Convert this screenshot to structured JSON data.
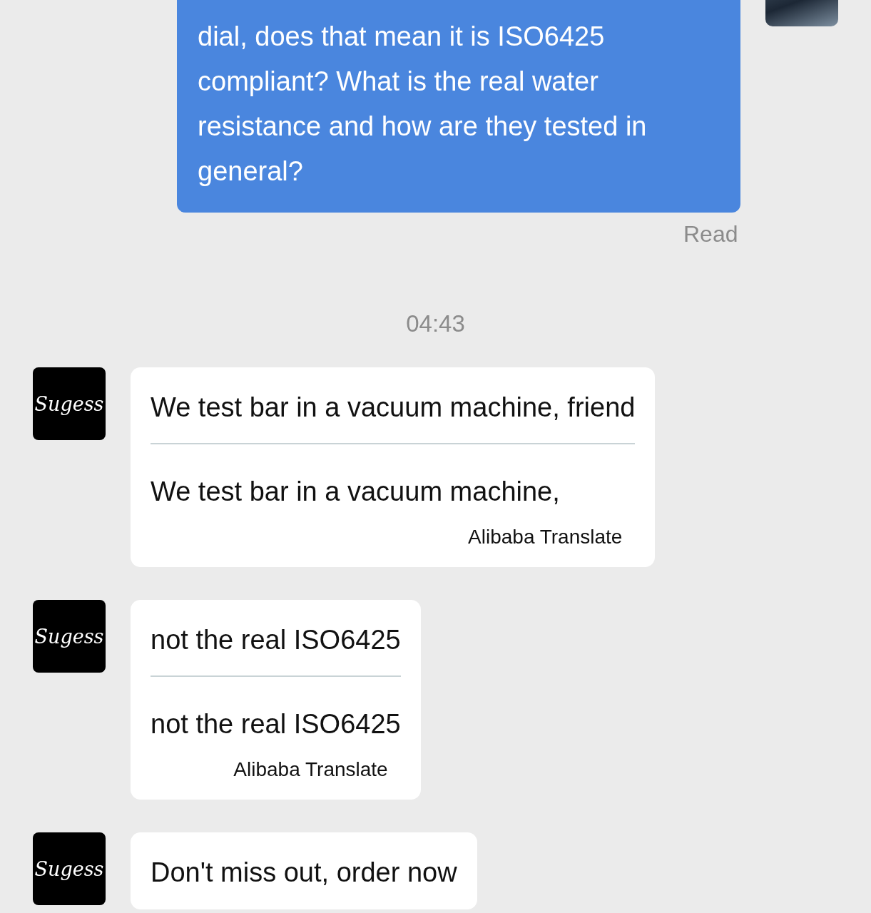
{
  "outgoing": {
    "text": "dial, does that mean it is ISO6425 compliant? What is the real water resistance and how are they tested in general?",
    "status": "Read"
  },
  "time": "04:43",
  "messages": [
    {
      "sender_logo": "Sugess",
      "kind": "translated",
      "original": "We test bar in a vacuum machine, friend",
      "translation": "We test bar in a vacuum machine,",
      "credit": "Alibaba Translate"
    },
    {
      "sender_logo": "Sugess",
      "kind": "translated",
      "original": "not the real ISO6425",
      "translation": "not the real ISO6425",
      "credit": "Alibaba Translate"
    },
    {
      "sender_logo": "Sugess",
      "kind": "plain",
      "original": "Don't miss out, order now"
    }
  ]
}
